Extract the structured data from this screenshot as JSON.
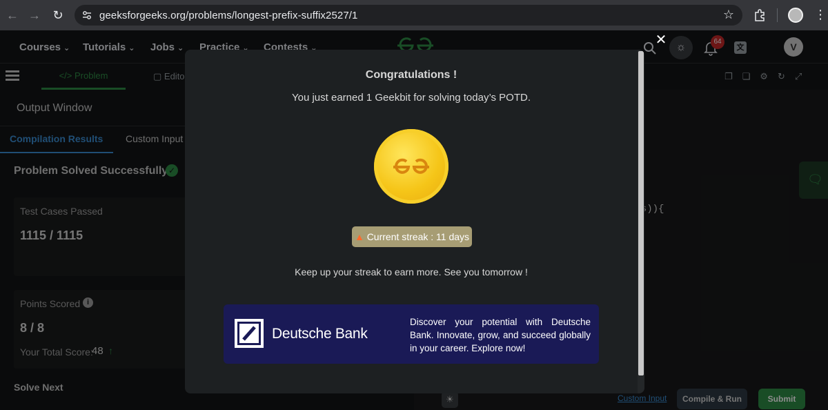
{
  "browser": {
    "url": "geeksforgeeks.org/problems/longest-prefix-suffix2527/1"
  },
  "nav": {
    "items": [
      "Courses",
      "Tutorials",
      "Jobs",
      "Practice",
      "Contests"
    ],
    "notification_count": "64",
    "avatar_letter": "V"
  },
  "toolbar": {
    "problem_tab": "</> Problem",
    "editorial_tab": "Editor"
  },
  "left": {
    "output_window": "Output Window",
    "tab_compilation": "Compilation Results",
    "tab_custom": "Custom Input",
    "solved_title": "Problem Solved Successfully",
    "tests_label": "Test Cases Passed",
    "tests_value": "1115 / 1115",
    "points_label": "Points Scored",
    "points_value": "8 / 8",
    "total_label": "Your Total Score:",
    "total_value": "48",
    "solve_next": "Solve Next"
  },
  "editor": {
    "code_fragment": "t(s)){"
  },
  "bottom": {
    "custom_input": "Custom Input",
    "compile_run": "Compile & Run",
    "submit": "Submit"
  },
  "modal": {
    "title": "Congratulations !",
    "subtitle": "You just earned 1 Geekbit for solving today’s POTD.",
    "streak": "Current streak : 11 days",
    "keep_up": "Keep up your streak to earn more. See you tomorrow !",
    "ad": {
      "brand": "Deutsche Bank",
      "text": "Discover your potential with Deutsche Bank. Innovate, grow, and succeed globally in your career. Explore now!"
    }
  },
  "colors": {
    "accent_green": "#2f8d46",
    "link_blue": "#3b8fd6",
    "coin_gold": "#f5c518",
    "ad_navy": "#1a1a56",
    "badge_red": "#c62828"
  }
}
